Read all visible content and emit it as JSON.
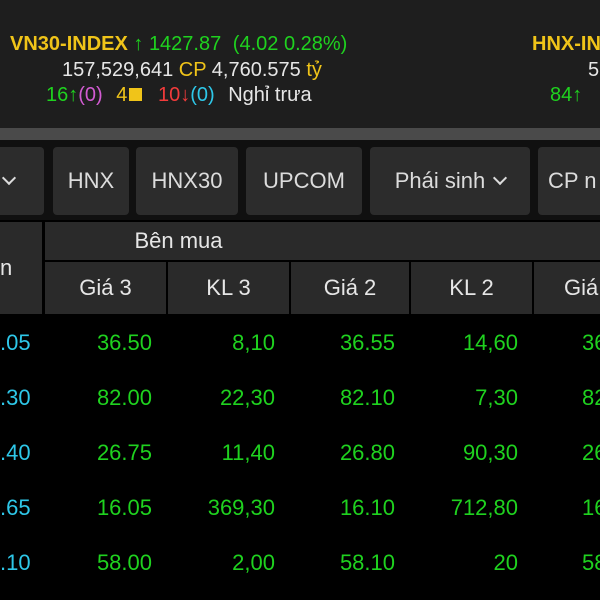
{
  "index_bar": {
    "vn30": {
      "name": "VN30-INDEX",
      "arrow": "↑",
      "value": "1427.87",
      "change": "(4.02  0.28%)",
      "volume": "157,529,641",
      "cp_label": "CP",
      "turnover": "4,760.575",
      "currency": "tỷ",
      "up_count": "16",
      "up_arrow": "↑",
      "ceiling": "(0)",
      "ref_count": "4",
      "down_count": "10",
      "down_arrow": "↓",
      "floor": "(0)",
      "session": "Nghỉ trưa"
    },
    "hnx": {
      "name": "HNX-IN",
      "volume": "5",
      "up_count": "84",
      "up_arrow": "↑"
    }
  },
  "tabs": [
    {
      "label": "",
      "has_dropdown": true
    },
    {
      "label": "HNX",
      "has_dropdown": false
    },
    {
      "label": "HNX30",
      "has_dropdown": false
    },
    {
      "label": "UPCOM",
      "has_dropdown": false
    },
    {
      "label": "Phái sinh",
      "has_dropdown": true
    },
    {
      "label": "CP n",
      "has_dropdown": false
    }
  ],
  "table": {
    "group_header": "Bên mua",
    "left_header": "n",
    "columns": [
      "Giá 3",
      "KL 3",
      "Giá 2",
      "KL 2",
      "Giá"
    ],
    "rows": [
      [
        ".05",
        "36.50",
        "8,10",
        "36.55",
        "14,60",
        "36"
      ],
      [
        ".30",
        "82.00",
        "22,30",
        "82.10",
        "7,30",
        "82"
      ],
      [
        ".40",
        "26.75",
        "11,40",
        "26.80",
        "90,30",
        "26"
      ],
      [
        ".65",
        "16.05",
        "369,30",
        "16.10",
        "712,80",
        "16"
      ],
      [
        ".10",
        "58.00",
        "2,00",
        "58.10",
        "20",
        "58"
      ]
    ]
  },
  "colors": {
    "up": "#1fd21f",
    "ref": "#f0c419",
    "down": "#f23b3b",
    "ceiling": "#d25bd2",
    "floor": "#2ec7e8",
    "header_bg": "#2a2a2a",
    "row_bg": "#000000"
  }
}
